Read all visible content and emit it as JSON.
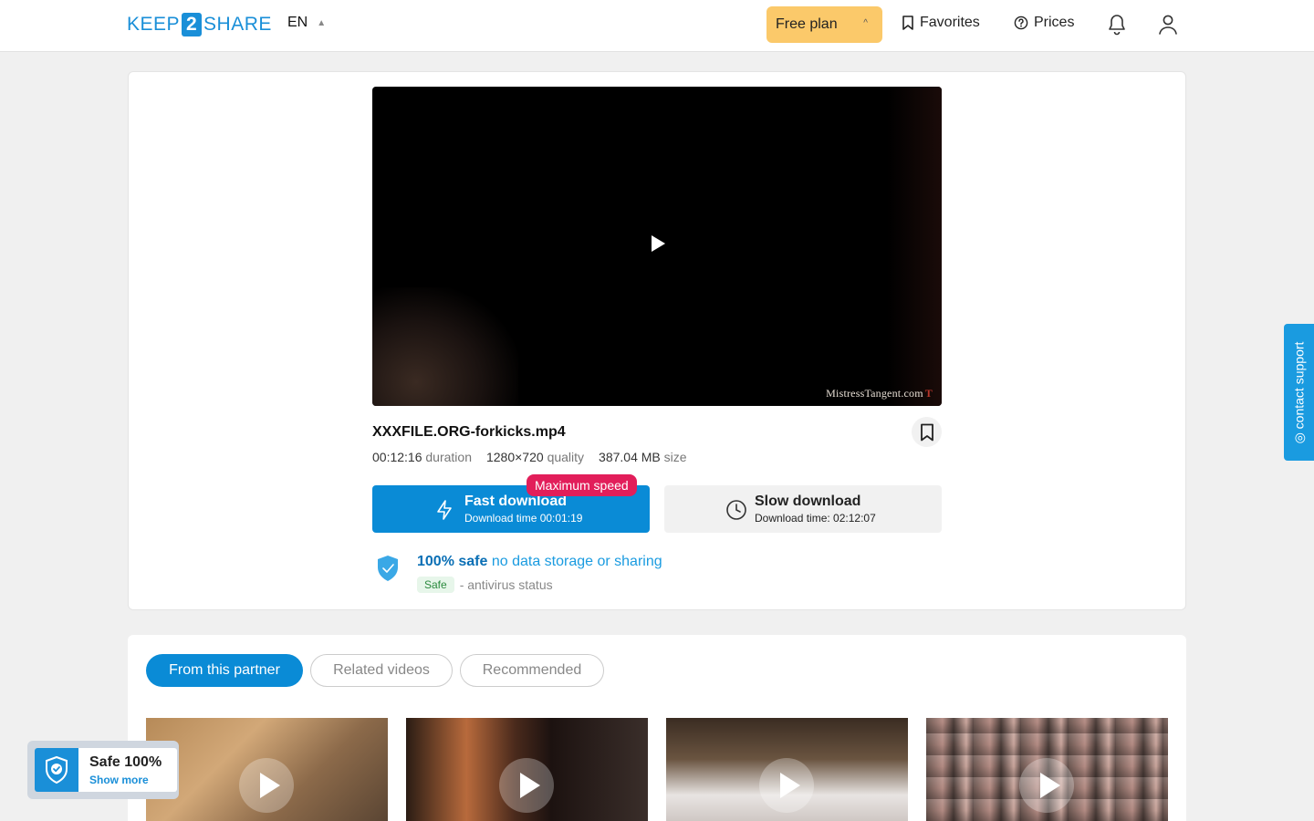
{
  "header": {
    "logo_left": "KEEP",
    "logo_mid": "2",
    "logo_right": "SHARE",
    "language": "EN",
    "plan_label": "Free plan",
    "favorites_label": "Favorites",
    "prices_label": "Prices"
  },
  "player": {
    "watermark": "MistressTangent.com",
    "watermark_mark": "T"
  },
  "file": {
    "name": "XXXFILE.ORG-forkicks.mp4",
    "duration_value": "00:12:16",
    "duration_label": "duration",
    "quality_value": "1280×720",
    "quality_label": "quality",
    "size_value": "387.04 MB",
    "size_label": "size"
  },
  "download": {
    "badge": "Maximum speed",
    "fast_label": "Fast download",
    "fast_time": "Download time 00:01:19",
    "slow_label": "Slow download",
    "slow_time": "Download time: 02:12:07"
  },
  "safety": {
    "headline_strong": "100% safe",
    "headline_light": "no data storage or sharing",
    "status_tag": "Safe",
    "status_text": "- antivirus status"
  },
  "contact_support": "contact support",
  "related_tabs": [
    {
      "label": "From this partner",
      "active": true
    },
    {
      "label": "Related videos",
      "active": false
    },
    {
      "label": "Recommended",
      "active": false
    }
  ],
  "safe_widget": {
    "title": "Safe 100%",
    "link": "Show more"
  },
  "colors": {
    "brand_blue": "#0a8bd6",
    "plan_yellow": "#fbc96a",
    "badge_pink": "#e21e5a",
    "safe_green": "#2b8a3e"
  },
  "icons": [
    "bookmark-icon",
    "help-circle-icon",
    "bell-icon",
    "user-icon",
    "lightning-icon",
    "clock-icon",
    "shield-check-icon",
    "play-icon",
    "chevron-up-icon"
  ]
}
